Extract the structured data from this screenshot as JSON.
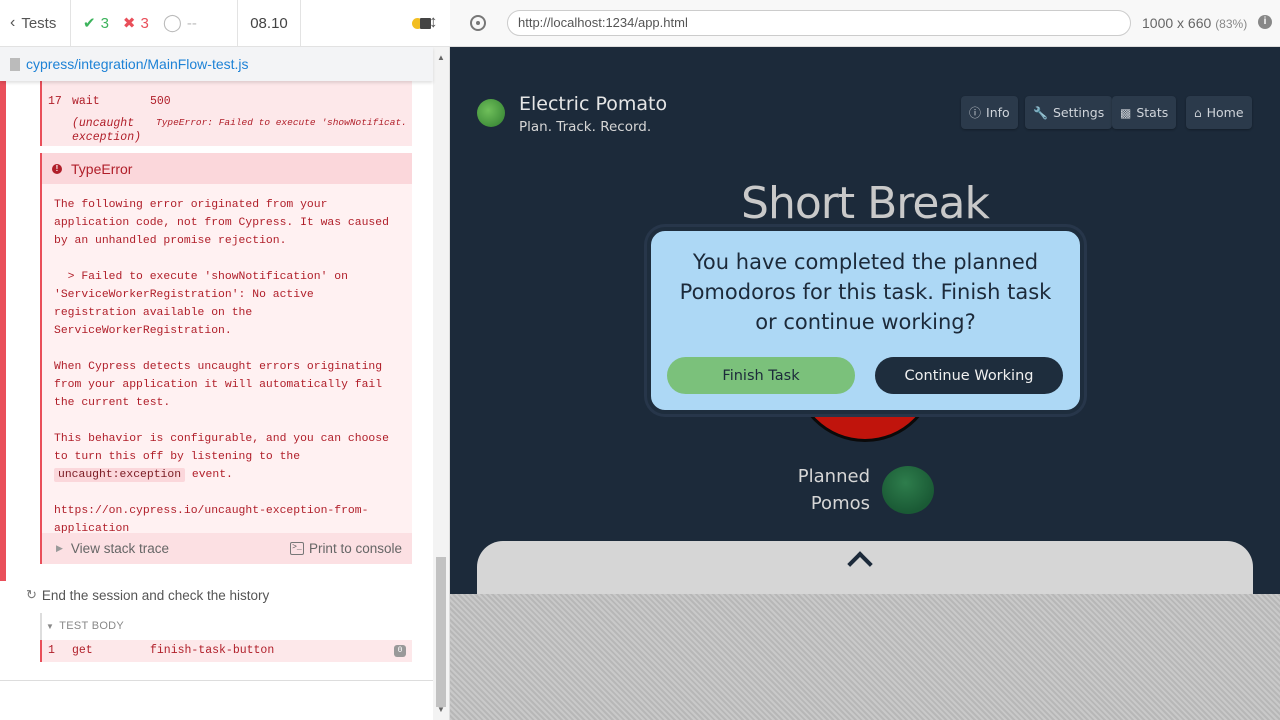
{
  "reporter": {
    "tests_label": "Tests",
    "passed": "3",
    "failed": "3",
    "pending": "--",
    "duration": "08.10",
    "spec_path": "cypress/integration/MainFlow-test.js"
  },
  "commands": [
    {
      "num": "17",
      "name": "wait",
      "msg": "500"
    },
    {
      "num": "",
      "name": "(uncaught exception)",
      "msg": "TypeError: Failed to execute 'showNotificat..."
    }
  ],
  "error": {
    "title": "TypeError",
    "p1": "The following error originated from your application code, not from Cypress. It was caused by an unhandled promise rejection.",
    "p2": "  > Failed to execute 'showNotification' on 'ServiceWorkerRegistration': No active registration available on the ServiceWorkerRegistration.",
    "p3": "When Cypress detects uncaught errors originating from your application it will automatically fail the current test.",
    "p4_pre": "This behavior is configurable, and you can choose to turn this off by listening to the",
    "p4_code": "uncaught:exception",
    "p4_post": " event.",
    "p5": "https://on.cypress.io/uncaught-exception-from-application",
    "stack_label": "View stack trace",
    "print_label": "Print to console"
  },
  "test2": {
    "title": "End the session and check the history",
    "body_label": "TEST BODY",
    "cmd": {
      "num": "1",
      "name": "get",
      "msg": "finish-task-button",
      "badge": "0"
    }
  },
  "browser": {
    "url": "http://localhost:1234/app.html",
    "viewport": "1000 x 660",
    "scale": "(83%)"
  },
  "app": {
    "title": "Electric Pomato",
    "subtitle": "Plan. Track. Record.",
    "nav": [
      {
        "label": "Info",
        "icon": "info-icon"
      },
      {
        "label": "Settings",
        "icon": "wrench-icon"
      },
      {
        "label": "Stats",
        "icon": "chart-icon"
      },
      {
        "label": "Home",
        "icon": "home-icon"
      }
    ],
    "mode": "Short Break",
    "planned_line1": "Planned",
    "planned_line2": "Pomos",
    "modal": {
      "text": "You have completed the planned Pomodoros for this task. Finish task or continue working?",
      "finish_label": "Finish Task",
      "continue_label": "Continue Working"
    }
  },
  "colors": {
    "fail": "#e94f5a",
    "pass": "#3cb35c",
    "app_bg": "#1c2a3a",
    "modal_bg": "#add8f5",
    "finish_btn": "#7bc17b",
    "timer_red": "#c0140c"
  }
}
